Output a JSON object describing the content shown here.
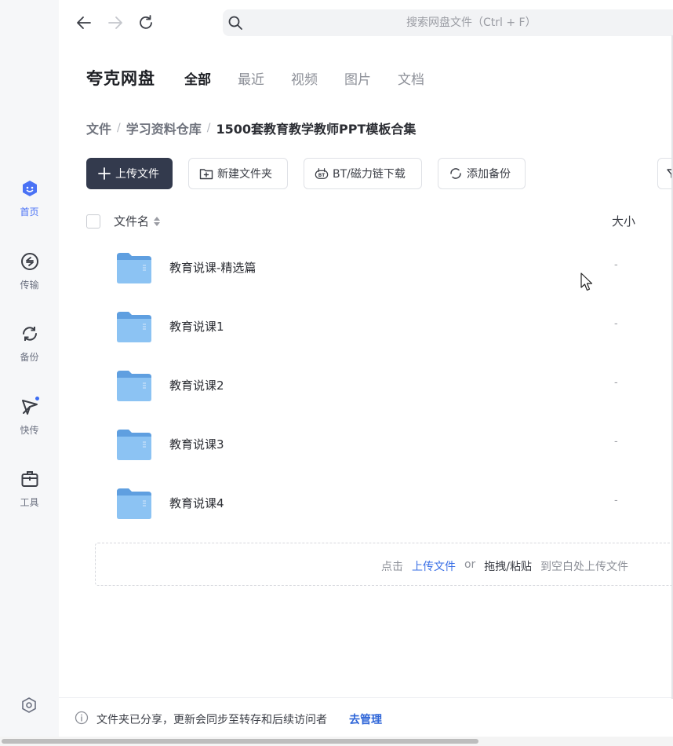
{
  "sidebar": {
    "items": [
      {
        "label": "首页",
        "icon": "home-face-icon"
      },
      {
        "label": "传输",
        "icon": "transfer-icon"
      },
      {
        "label": "备份",
        "icon": "backup-sync-icon"
      },
      {
        "label": "快传",
        "icon": "quick-send-icon"
      },
      {
        "label": "工具",
        "icon": "toolbox-icon"
      }
    ],
    "active_color": "#4a72f5"
  },
  "search": {
    "placeholder": "搜索网盘文件（Ctrl + F）"
  },
  "header": {
    "brand": "夸克网盘",
    "tabs": [
      "全部",
      "最近",
      "视频",
      "图片",
      "文档"
    ],
    "active_tab": "全部"
  },
  "breadcrumb": [
    "文件",
    "学习资料仓库",
    "1500套教育教学教师PPT模板合集"
  ],
  "toolbar": {
    "upload": "上传文件",
    "new_folder": "新建文件夹",
    "bt_download": "BT/磁力链下载",
    "add_backup": "添加备份"
  },
  "table": {
    "col_name": "文件名",
    "col_size": "大小",
    "rows": [
      {
        "name": "教育说课-精选篇",
        "size": "-"
      },
      {
        "name": "教育说课1",
        "size": "-"
      },
      {
        "name": "教育说课2",
        "size": "-"
      },
      {
        "name": "教育说课3",
        "size": "-"
      },
      {
        "name": "教育说课4",
        "size": "-"
      }
    ]
  },
  "dropzone": {
    "prefix": "点击",
    "upload_link": "上传文件",
    "or": "or",
    "drag": "拖拽/粘贴",
    "suffix": "到空白处上传文件"
  },
  "notice": {
    "text": "文件夹已分享，更新会同步至转存和后续访问者",
    "link": "去管理"
  },
  "colors": {
    "primary_button": "#333a4d",
    "link": "#2f66d8",
    "folder": "#74b3ee"
  }
}
